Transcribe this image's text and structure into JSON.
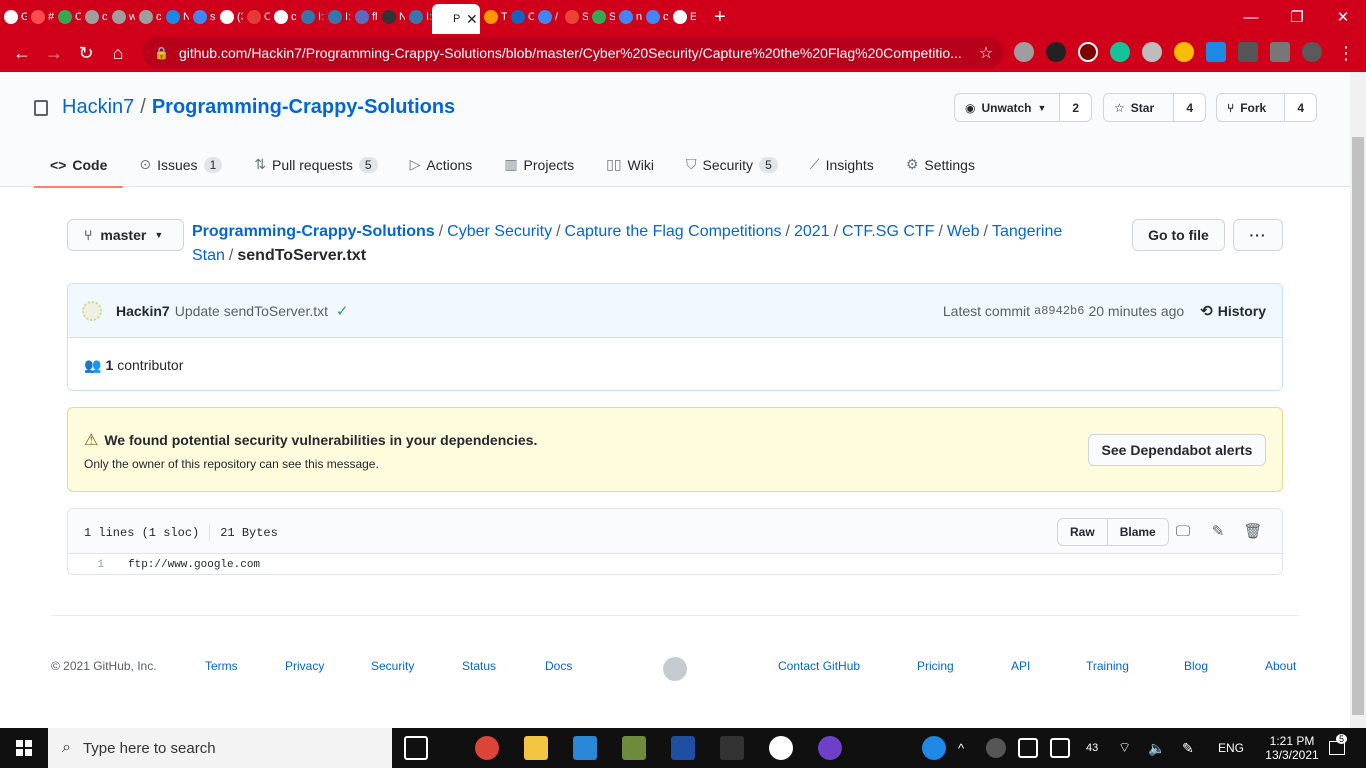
{
  "browser": {
    "tabs": [
      {
        "fav_color": "#ffffff",
        "title": "G"
      },
      {
        "fav_color": "#ff4d4d",
        "title": "#"
      },
      {
        "fav_color": "#34a853",
        "title": "C"
      },
      {
        "fav_color": "#9e9e9e",
        "title": "c"
      },
      {
        "fav_color": "#9e9e9e",
        "title": "w"
      },
      {
        "fav_color": "#9e9e9e",
        "title": "c"
      },
      {
        "fav_color": "#1e88e5",
        "title": "N"
      },
      {
        "fav_color": "#4285f4",
        "title": "sl"
      },
      {
        "fav_color": "#ffffff",
        "title": "(3"
      },
      {
        "fav_color": "#e53935",
        "title": "C"
      },
      {
        "fav_color": "#ffffff",
        "title": "c"
      },
      {
        "fav_color": "#3776ab",
        "title": "I:"
      },
      {
        "fav_color": "#3776ab",
        "title": "I:"
      },
      {
        "fav_color": "#5c6bc0",
        "title": "fl"
      },
      {
        "fav_color": "#333333",
        "title": "N"
      },
      {
        "fav_color": "#3776ab",
        "title": "I:"
      },
      {
        "fav_color": "#ffffff",
        "title": "Pr",
        "active": true
      },
      {
        "fav_color": "#ff9800",
        "title": "T"
      },
      {
        "fav_color": "#1565c0",
        "title": "C"
      },
      {
        "fav_color": "#4285f4",
        "title": "/"
      },
      {
        "fav_color": "#ea4335",
        "title": "S"
      },
      {
        "fav_color": "#34a853",
        "title": "S"
      },
      {
        "fav_color": "#4285f4",
        "title": "n"
      },
      {
        "fav_color": "#4285f4",
        "title": "c"
      },
      {
        "fav_color": "#ffffff",
        "title": "E"
      }
    ],
    "active_tab_close": "✕",
    "new_tab": "+",
    "window": {
      "minimize": "—",
      "maximize": "❐",
      "close": "✕"
    },
    "url": "github.com/Hackin7/Programming-Crappy-Solutions/blob/master/Cyber%20Security/Capture%20the%20Flag%20Competitio...",
    "chrome_color": "#d0001b"
  },
  "repo": {
    "owner": "Hackin7",
    "separator": "/",
    "name": "Programming-Crappy-Solutions",
    "unwatch_label": "Unwatch",
    "unwatch_count": "2",
    "star_label": "Star",
    "star_count": "4",
    "fork_label": "Fork",
    "fork_count": "4"
  },
  "nav": {
    "code": "Code",
    "issues": "Issues",
    "issues_count": "1",
    "pulls": "Pull requests",
    "pulls_count": "5",
    "actions": "Actions",
    "projects": "Projects",
    "wiki": "Wiki",
    "security": "Security",
    "security_count": "5",
    "insights": "Insights",
    "settings": "Settings"
  },
  "file": {
    "branch": "master",
    "breadcrumb": [
      "Programming-Crappy-Solutions",
      "Cyber Security",
      "Capture the Flag Competitions",
      "2021",
      "CTF.SG CTF",
      "Web",
      "Tangerine Stan"
    ],
    "filename": "sendToServer.txt",
    "go_to_file": "Go to file",
    "more": "···"
  },
  "commit": {
    "author": "Hackin7",
    "message": "Update sendToServer.txt",
    "latest_label": "Latest commit",
    "sha": "a8942b6",
    "time": "20 minutes ago",
    "history": "History",
    "contributors_count": "1",
    "contributors_label": "contributor"
  },
  "alert": {
    "title": "We found potential security vulnerabilities in your dependencies.",
    "subtitle": "Only the owner of this repository can see this message.",
    "button": "See Dependabot alerts"
  },
  "blob": {
    "lines_info": "1 lines (1 sloc)",
    "size": "21 Bytes",
    "raw": "Raw",
    "blame": "Blame",
    "line_number": "1",
    "line_content": "ftp://www.google.com"
  },
  "footer": {
    "copyright": "© 2021 GitHub, Inc.",
    "links": [
      "Terms",
      "Privacy",
      "Security",
      "Status",
      "Docs",
      "Contact GitHub",
      "Pricing",
      "API",
      "Training",
      "Blog",
      "About"
    ]
  },
  "taskbar": {
    "search_placeholder": "Type here to search",
    "battery": "43",
    "language": "ENG",
    "time": "1:21 PM",
    "date": "13/3/2021",
    "notifications": "5"
  }
}
